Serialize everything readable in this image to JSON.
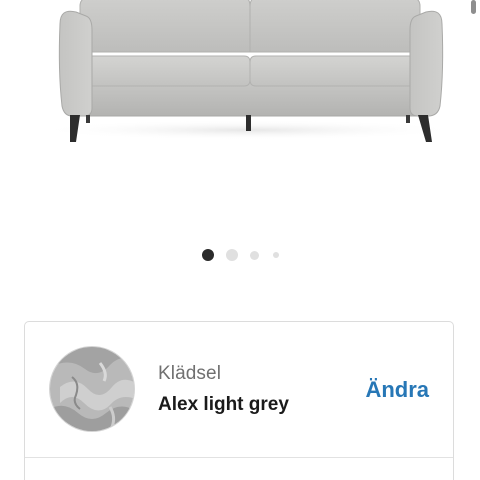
{
  "carousel": {
    "dot_count": 4,
    "active_index": 0
  },
  "product_image": {
    "icon": "sofa-image",
    "fabric_color": "#c9c9c7"
  },
  "option": {
    "label": "Klädsel",
    "value": "Alex light grey",
    "change_label": "Ändra",
    "swatch_icon": "fabric-swatch",
    "link_color": "#2777b6"
  }
}
